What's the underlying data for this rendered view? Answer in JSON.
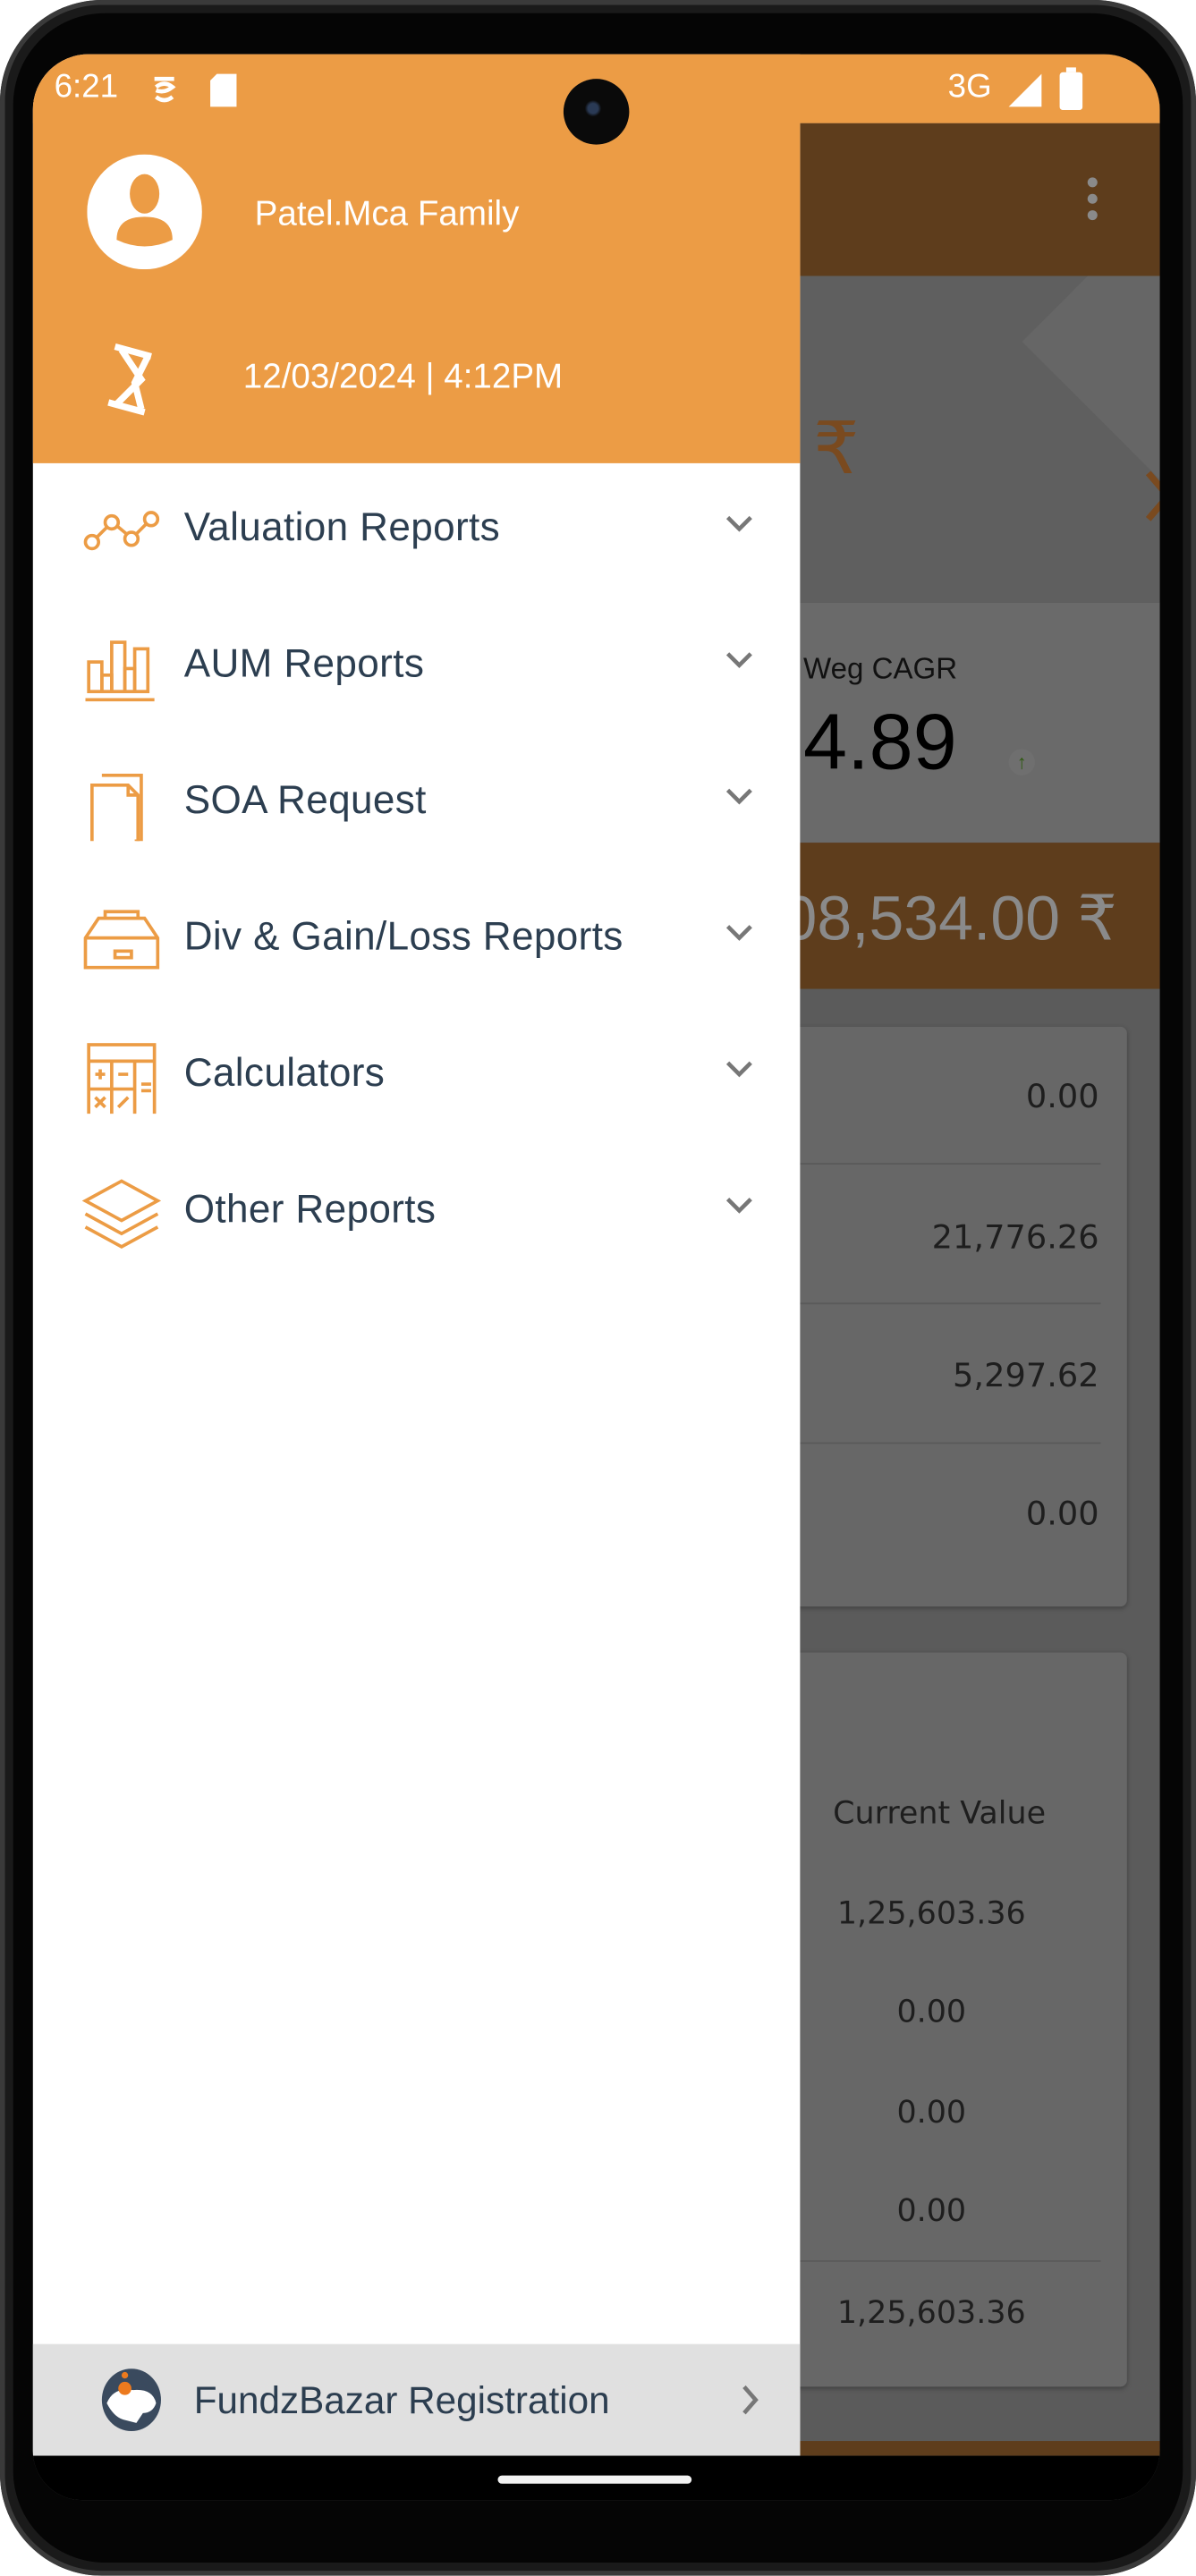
{
  "status_bar": {
    "time": "6:21",
    "network": "3G"
  },
  "drawer": {
    "user_name": "Patel.Mca Family",
    "last_updated": "12/03/2024 | 4:12PM",
    "menu": [
      {
        "label": "Valuation Reports",
        "icon": "trend-line-icon"
      },
      {
        "label": "AUM Reports",
        "icon": "bar-chart-icon"
      },
      {
        "label": "SOA Request",
        "icon": "documents-icon"
      },
      {
        "label": "Div & Gain/Loss Reports",
        "icon": "inbox-tray-icon"
      },
      {
        "label": "Calculators",
        "icon": "calculator-icon"
      },
      {
        "label": "Other Reports",
        "icon": "layers-icon"
      }
    ],
    "footer_item": {
      "label": "FundzBazar Registration",
      "icon": "fundzbazar-logo-icon"
    }
  },
  "background": {
    "currency_symbol": "₹",
    "cagr_label": "Weg CAGR",
    "cagr_value": "4.89",
    "total_value": "08,534.00 ₹",
    "summary_values": [
      "0.00",
      "21,776.26",
      "5,297.62",
      "0.00"
    ],
    "table_header": "Current Value",
    "table_values": [
      "1,25,603.36",
      "0.00",
      "0.00",
      "0.00"
    ],
    "table_total": "1,25,603.36"
  },
  "colors": {
    "accent": "#ec9c45",
    "text": "#2c3e50",
    "appbar_dimmed": "#5e3d1c"
  }
}
